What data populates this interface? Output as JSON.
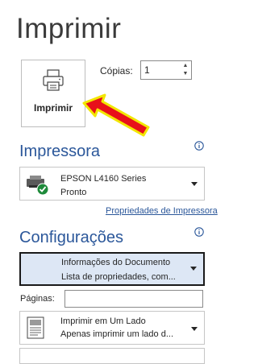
{
  "header": {
    "title": "Imprimir"
  },
  "print_button": {
    "label": "Imprimir"
  },
  "copies": {
    "label": "Cópias:",
    "value": "1"
  },
  "printer_section": {
    "title": "Impressora",
    "selected": {
      "name": "EPSON L4160 Series",
      "status": "Pronto"
    },
    "properties_link": "Propriedades de Impressora"
  },
  "config_section": {
    "title": "Configurações",
    "document_info": {
      "line1": "Informações do Documento",
      "line2": "Lista de propriedades, com..."
    },
    "pages": {
      "label": "Páginas:",
      "value": ""
    },
    "sides": {
      "line1": "Imprimir em Um Lado",
      "line2": "Apenas imprimir um lado d..."
    }
  },
  "colors": {
    "accent": "#2b579a",
    "highlight_bg": "#dde7f5",
    "arrow_fill": "#e8101a",
    "arrow_outline": "#f2e600",
    "status_ok": "#1e8a3a"
  },
  "icons": [
    "printer-icon",
    "info-icon",
    "printer-ready-icon",
    "document-icon",
    "chevron-down-icon",
    "red-arrow-annotation"
  ]
}
